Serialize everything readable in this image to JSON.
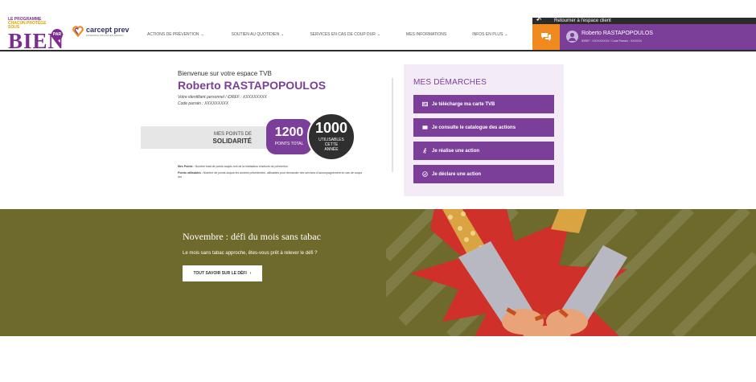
{
  "header": {
    "logo": {
      "line1": "LE PROGRAMME",
      "line2": "CHACUN PROTÈGE SOUS",
      "word": "BIEN",
      "par": "PAR",
      "brand": "carcept prev",
      "brand_sub": "ENSEMBLE PROTÉGER DEMAIN"
    },
    "nav": [
      {
        "label": "ACTIONS DE PRÉVENTION",
        "has_menu": true
      },
      {
        "label": "SOUTIEN AU QUOTIDIEN",
        "has_menu": true
      },
      {
        "label": "SERVICES EN CAS DE COUP DUR",
        "has_menu": true
      },
      {
        "label": "MES INFORMATIONS",
        "has_menu": false
      },
      {
        "label": "INFOS EN PLUS",
        "has_menu": true
      }
    ],
    "back_label": "Retourner à l'espace client",
    "user": {
      "name": "Roberto RASTAPOPOULOS",
      "ids": "IDREF : XXXXXXXXX / Code Parrain : XXXXXX"
    }
  },
  "welcome": {
    "greeting": "Bienvenue sur votre espace TVB",
    "name": "Roberto RASTAPOPOULOS",
    "id_line": "Votre identifiant personnel / iDREF : XXXXXXXXX",
    "sponsor_line": "Code parrain : XXXXXXXXX"
  },
  "points": {
    "label_line1": "MES POINTS DE",
    "label_line2": "SOLIDARITÉ",
    "total": "1200",
    "total_label": "POINTS TOTAL",
    "usable": "1000",
    "usable_label1": "UTILISABLES",
    "usable_label2": "CETTE",
    "usable_label3": "ANNÉE"
  },
  "notes": {
    "n1_title": "Mes Points :",
    "n1_text": " Nombre total de points acquis lors de la réalisation d'actions de prévention",
    "n2_title": "Points utilisables :",
    "n2_text": " Nombre de points acquis les années précédentes, utilisables pour demander des services d'accompagnement en cas de coups dur"
  },
  "demarches": {
    "title": "MES DÉMARCHES",
    "actions": [
      {
        "label": "Je télécharge ma carte TVB",
        "icon": "id-card-icon"
      },
      {
        "label": "Je consulte le catalogue des actions",
        "icon": "book-icon"
      },
      {
        "label": "Je réalise une action",
        "icon": "running-icon"
      },
      {
        "label": "Je déclare une action",
        "icon": "check-circle-icon"
      }
    ]
  },
  "banner": {
    "title": "Novembre : défi du mois sans tabac",
    "subtitle": "Le mois sans tabac approche, êtes-vous prêt à relever le défi ?",
    "cta": "TOUT SAVOIR SUR LE DÉFI"
  },
  "colors": {
    "brand_purple": "#7b3f99",
    "chat_orange": "#f08a1e",
    "banner_olive": "#6e6a2c",
    "panel_bg": "#f3ebf6"
  }
}
